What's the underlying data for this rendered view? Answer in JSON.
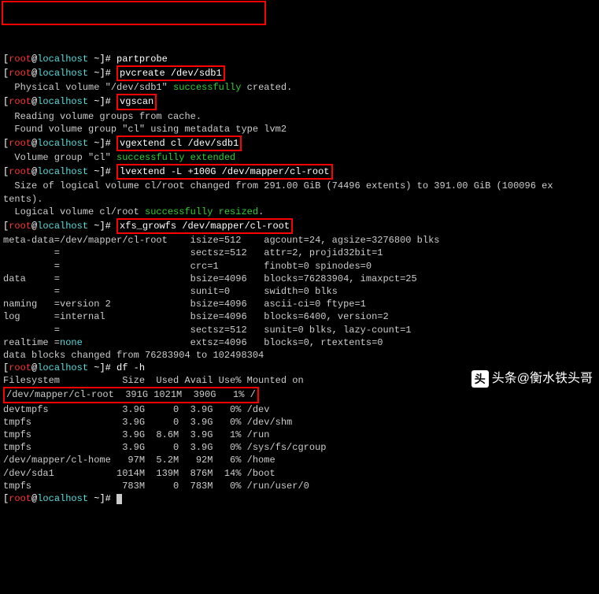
{
  "prompt": {
    "lbracket": "[",
    "user": "root",
    "at": "@",
    "host": "localhost",
    "tilde": " ~",
    "rbracket": "]",
    "hash": "# "
  },
  "cmds": {
    "partprobe": "partprobe",
    "pvcreate": "pvcreate /dev/sdb1",
    "vgscan": "vgscan",
    "vgextend": "vgextend cl /dev/sdb1",
    "lvextend": "lvextend -L +100G /dev/mapper/cl-root",
    "xfsgrowfs": "xfs_growfs /dev/mapper/cl-root",
    "dfh": "df -h"
  },
  "out": {
    "pv_pre": "  Physical volume \"/dev/sdb1\" ",
    "pv_succ": "successfully",
    "pv_post": " created.",
    "vgs1": "  Reading volume groups from cache.",
    "vgs2_pre": "  Found volume group \"cl\" using metadata type lvm2",
    "vge_pre": "  Volume group \"cl\" ",
    "vge_succ": "successfully extended",
    "lve1": "  Size of logical volume cl/root changed from 291.00 GiB (74496 extents) to 391.00 GiB (100096 ex",
    "lve1b": "tents).",
    "lve2_pre": "  Logical volume cl/root ",
    "lve2_succ": "successfully resized",
    "xfs_meta": "meta-data=/dev/mapper/cl-root    isize=512    agcount=24, agsize=3276800 blks",
    "xfs_l2": "         =                       sectsz=512   attr=2, projid32bit=1",
    "xfs_l3": "         =                       crc=1        finobt=0 spinodes=0",
    "xfs_l4": "data     =                       bsize=4096   blocks=76283904, imaxpct=25",
    "xfs_l5": "         =                       sunit=0      swidth=0 blks",
    "xfs_l6": "naming   =version 2              bsize=4096   ascii-ci=0 ftype=1",
    "xfs_l7": "log      =internal               bsize=4096   blocks=6400, version=2",
    "xfs_l8": "         =                       sectsz=512   sunit=0 blks, lazy-count=1",
    "xfs_l9a": "realtime =",
    "xfs_none": "none",
    "xfs_l9b": "                   extsz=4096   blocks=0, rtextents=0",
    "xfs_l10": "data blocks changed from 76283904 to 102498304",
    "df_hdr": "Filesystem           Size  Used Avail Use% Mounted on",
    "df_r1": "/dev/mapper/cl-root  391G 1021M  390G   1% /",
    "df_r2": "devtmpfs             3.9G     0  3.9G   0% /dev",
    "df_r3": "tmpfs                3.9G     0  3.9G   0% /dev/shm",
    "df_r4": "tmpfs                3.9G  8.6M  3.9G   1% /run",
    "df_r5": "tmpfs                3.9G     0  3.9G   0% /sys/fs/cgroup",
    "df_r6": "/dev/mapper/cl-home   97M  5.2M   92M   6% /home",
    "df_r7": "/dev/sda1           1014M  139M  876M  14% /boot",
    "df_r8": "tmpfs                783M     0  783M   0% /run/user/0"
  },
  "watermark": {
    "prefix": "头条",
    "at": "@",
    "name": "衡水铁头哥"
  }
}
